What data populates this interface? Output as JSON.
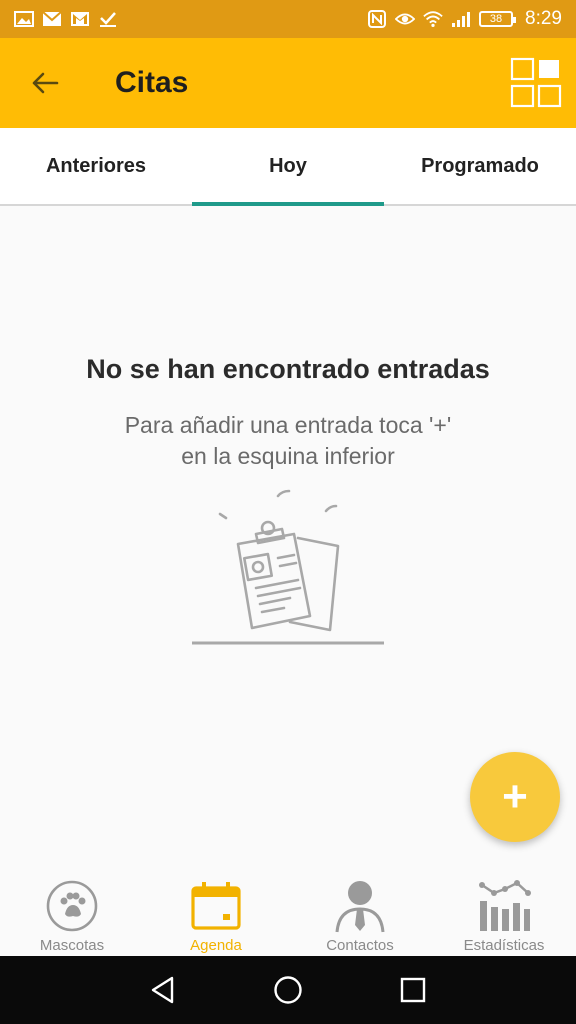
{
  "status_bar": {
    "time": "8:29",
    "battery": "38",
    "left_icons": [
      "gallery-icon",
      "mail-icon",
      "gmail-icon",
      "check-icon"
    ],
    "right_icons": [
      "nfc-icon",
      "eye-icon",
      "wifi-icon",
      "signal-icon",
      "battery-icon"
    ]
  },
  "app_bar": {
    "title": "Citas",
    "color": "#ffbc05"
  },
  "tabs": [
    {
      "label": "Anteriores",
      "active": false
    },
    {
      "label": "Hoy",
      "active": true
    },
    {
      "label": "Programado",
      "active": false
    }
  ],
  "empty_state": {
    "title": "No se han encontrado entradas",
    "subtitle_line1": "Para añadir una entrada toca '+'",
    "subtitle_line2": "en la esquina inferior"
  },
  "fab": {
    "label": "+",
    "color": "#f8c93c"
  },
  "bottom_nav": [
    {
      "label": "Mascotas",
      "icon": "paw-icon",
      "active": false
    },
    {
      "label": "Agenda",
      "icon": "calendar-icon",
      "active": true
    },
    {
      "label": "Contactos",
      "icon": "person-icon",
      "active": false
    },
    {
      "label": "Estadísticas",
      "icon": "stats-icon",
      "active": false
    }
  ],
  "colors": {
    "accent": "#ffbc05",
    "tab_indicator": "#1f9a8a",
    "active_nav": "#f2b200"
  }
}
